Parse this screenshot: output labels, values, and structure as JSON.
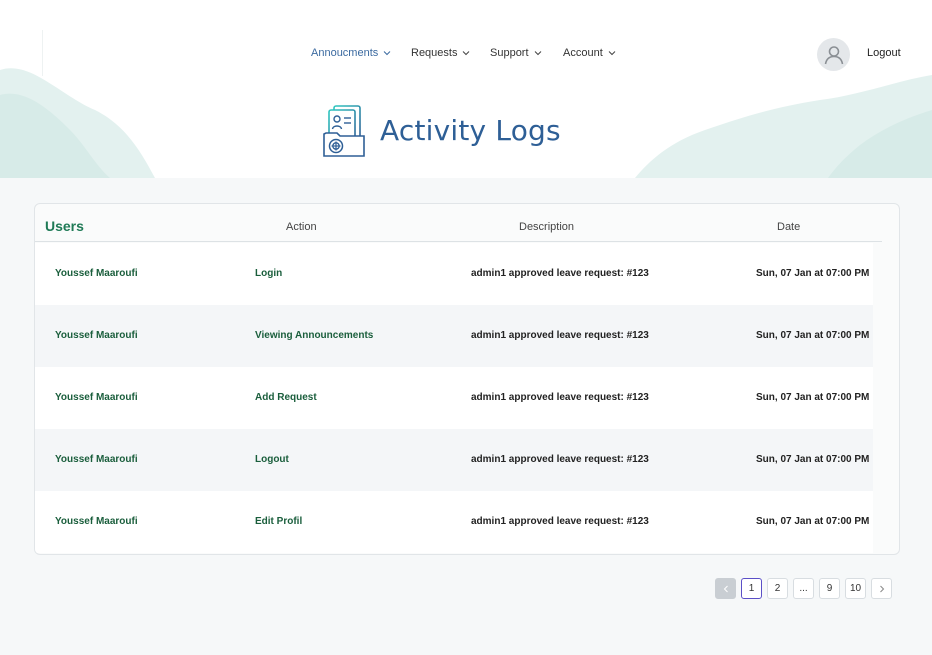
{
  "header": {
    "nav": [
      {
        "label": "Annoucments",
        "active": true
      },
      {
        "label": "Requests",
        "active": false
      },
      {
        "label": "Support",
        "active": false
      },
      {
        "label": "Account",
        "active": false
      }
    ],
    "logout_label": "Logout",
    "avatar_icon": "user-icon"
  },
  "page": {
    "title": "Activity Logs",
    "title_icon": "activity-log-icon",
    "accent": "#2e5f96",
    "green": "#1f7a56"
  },
  "table": {
    "columns": {
      "users": "Users",
      "action": "Action",
      "description": "Description",
      "date": "Date"
    },
    "rows": [
      {
        "user": "Youssef Maaroufi",
        "action": "Login",
        "description": "admin1 approved leave request: #123",
        "date": "Sun, 07 Jan at 07:00 PM"
      },
      {
        "user": "Youssef Maaroufi",
        "action": "Viewing Announcements",
        "description": "admin1 approved leave request: #123",
        "date": "Sun, 07 Jan at 07:00 PM"
      },
      {
        "user": "Youssef Maaroufi",
        "action": "Add Request",
        "description": "admin1 approved leave request: #123",
        "date": "Sun, 07 Jan at 07:00 PM"
      },
      {
        "user": "Youssef Maaroufi",
        "action": "Logout",
        "description": "admin1 approved leave request: #123",
        "date": "Sun, 07 Jan at 07:00 PM"
      },
      {
        "user": "Youssef Maaroufi",
        "action": "Edit Profil",
        "description": "admin1 approved leave request: #123",
        "date": "Sun, 07 Jan at 07:00 PM"
      }
    ]
  },
  "pagination": {
    "prev_icon": "chevron-left-icon",
    "next_icon": "chevron-right-icon",
    "pages": [
      "1",
      "2",
      "...",
      "9",
      "10"
    ],
    "current": "1"
  }
}
